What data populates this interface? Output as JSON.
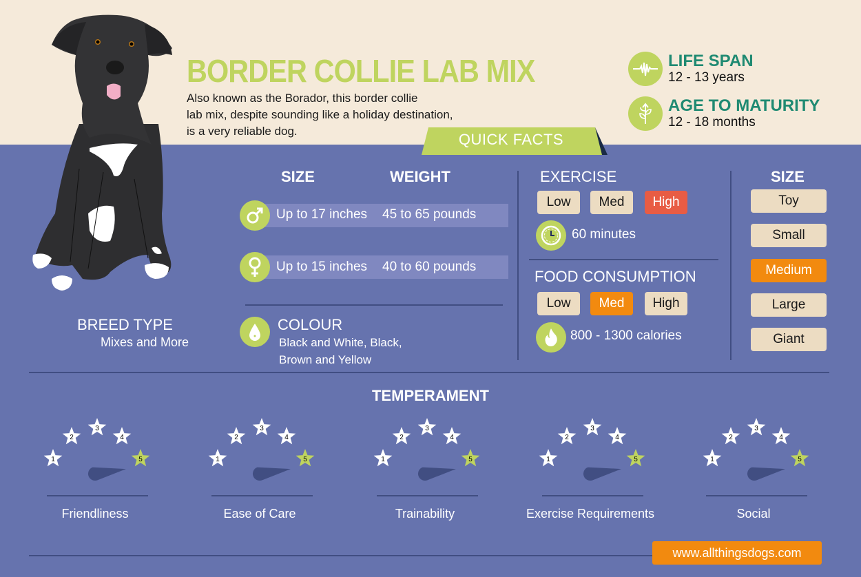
{
  "header": {
    "title": "BORDER COLLIE LAB MIX",
    "intro_lines": [
      "Also known as the Borador, this border collie",
      "lab mix, despite sounding like a holiday destination,",
      "is a very reliable dog."
    ]
  },
  "stats": {
    "life_span": {
      "icon": "heartbeat-icon",
      "label": "LIFE SPAN",
      "value": "12 - 13 years"
    },
    "maturity": {
      "icon": "sprout-icon",
      "label": "AGE TO MATURITY",
      "value": "12 - 18 months"
    }
  },
  "quick_facts_label": "QUICK FACTS",
  "size_weight": {
    "size_header": "SIZE",
    "weight_header": "WEIGHT",
    "male": {
      "icon": "male-icon",
      "size": "Up to 17 inches",
      "weight": "45 to 65 pounds"
    },
    "female": {
      "icon": "female-icon",
      "size": "Up to 15 inches",
      "weight": "40 to 60 pounds"
    }
  },
  "colour": {
    "icon": "droplet-icon",
    "header": "COLOUR",
    "lines": [
      "Black and White, Black,",
      "Brown and Yellow"
    ]
  },
  "breed_type": {
    "header": "BREED TYPE",
    "value": "Mixes and More"
  },
  "exercise": {
    "header": "EXERCISE",
    "levels": [
      "Low",
      "Med",
      "High"
    ],
    "selected": "High",
    "icon": "clock-icon",
    "value": "60 minutes"
  },
  "food": {
    "header": "FOOD CONSUMPTION",
    "levels": [
      "Low",
      "Med",
      "High"
    ],
    "selected": "Med",
    "icon": "flame-icon",
    "value": "800 - 1300 calories"
  },
  "size_scale": {
    "header": "SIZE",
    "options": [
      "Toy",
      "Small",
      "Medium",
      "Large",
      "Giant"
    ],
    "selected": "Medium"
  },
  "temperament": {
    "header": "TEMPERAMENT",
    "items": [
      {
        "label": "Friendliness",
        "rating": 5,
        "max": 5
      },
      {
        "label": "Ease of Care",
        "rating": 5,
        "max": 5
      },
      {
        "label": "Trainability",
        "rating": 5,
        "max": 5
      },
      {
        "label": "Exercise Requirements",
        "rating": 5,
        "max": 5
      },
      {
        "label": "Social",
        "rating": 5,
        "max": 5
      }
    ]
  },
  "footer": {
    "site": "www.allthingsdogs.com"
  },
  "colors": {
    "accent_green": "#bfd45f",
    "teal": "#1f8a72",
    "orange": "#f28a0f",
    "red": "#e85c44",
    "pill": "#ecdcc2",
    "background": "#6673ae",
    "cream": "#f5eada"
  }
}
